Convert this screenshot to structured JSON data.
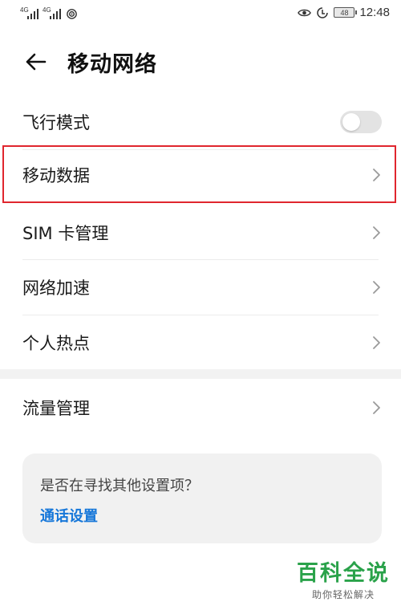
{
  "status_bar": {
    "signal_tag_1": "4G",
    "signal_tag_2": "4G",
    "battery": "48",
    "time": "12:48"
  },
  "header": {
    "title": "移动网络"
  },
  "settings": {
    "airplane_mode": {
      "label": "飞行模式",
      "enabled": false
    },
    "mobile_data": {
      "label": "移动数据"
    },
    "sim_management": {
      "label": "SIM 卡管理"
    },
    "network_boost": {
      "label": "网络加速"
    },
    "hotspot": {
      "label": "个人热点"
    },
    "data_usage": {
      "label": "流量管理"
    }
  },
  "suggestion": {
    "question": "是否在寻找其他设置项？",
    "link": "通话设置"
  },
  "watermark": {
    "brand": "百科全说",
    "tagline": "助你轻松解决"
  },
  "colors": {
    "highlight": "#e0262e",
    "link": "#1677d9",
    "watermark_brand": "#2aa24a"
  }
}
